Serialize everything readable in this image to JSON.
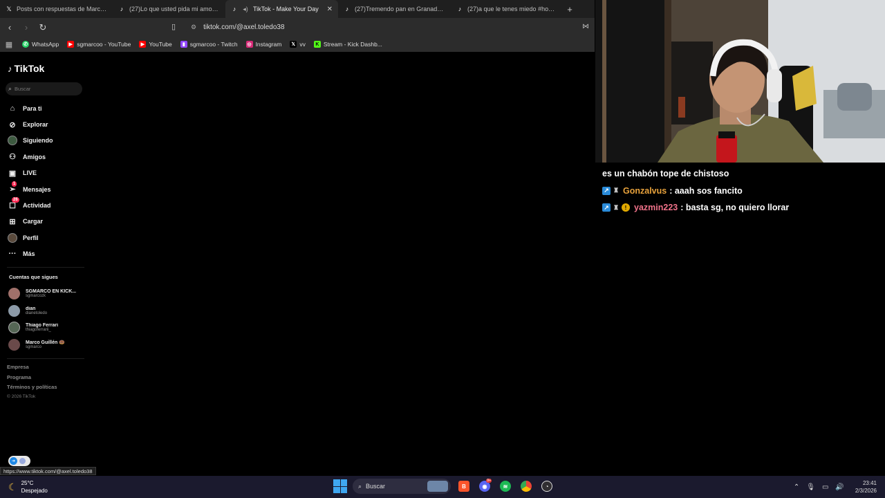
{
  "browser": {
    "tabs": [
      {
        "icon": "x-icon",
        "title": "Posts con respuestas de Marco Guillén",
        "active": false
      },
      {
        "icon": "tiktok-icon",
        "title": "(27)Lo que usted pida mi amor #fyp",
        "active": false
      },
      {
        "icon": "sound-icon",
        "title": "TikTok - Make Your Day",
        "active": true
      },
      {
        "icon": "tiktok-icon",
        "title": "(27)Tremendo pan en Granada: ¡Descubrí",
        "active": false
      },
      {
        "icon": "tiktok-icon",
        "title": "(27)a que le tenes miedo #hopecore",
        "active": false
      }
    ],
    "new_tab": "+",
    "close_glyph": "✕",
    "url": "tiktok.com/@axel.toledo38",
    "bookmarks": [
      {
        "label": "WhatsApp",
        "color": "#25d366"
      },
      {
        "label": "sgmarcoo - YouTube",
        "color": "#ff0000"
      },
      {
        "label": "YouTube",
        "color": "#ff0000"
      },
      {
        "label": "sgmarcoo - Twitch",
        "color": "#9146ff"
      },
      {
        "label": "Instagram",
        "color": "#d62976"
      },
      {
        "label": "vv",
        "color": "#000000"
      },
      {
        "label": "Stream - Kick Dashb...",
        "color": "#53fc18"
      }
    ],
    "status_url": "https://www.tiktok.com/@axel.toledo38"
  },
  "tiktok": {
    "logo": "TikTok",
    "search_placeholder": "Buscar",
    "nav": [
      {
        "label": "Para ti",
        "icon": "home-icon"
      },
      {
        "label": "Explorar",
        "icon": "compass-icon"
      },
      {
        "label": "Siguiendo",
        "icon": "following-avatar-icon"
      },
      {
        "label": "Amigos",
        "icon": "friends-icon"
      },
      {
        "label": "LIVE",
        "icon": "live-icon"
      },
      {
        "label": "Mensajes",
        "icon": "messages-icon",
        "badge": "1"
      },
      {
        "label": "Actividad",
        "icon": "activity-icon",
        "badge": "26"
      },
      {
        "label": "Cargar",
        "icon": "upload-icon"
      },
      {
        "label": "Perfil",
        "icon": "profile-avatar-icon"
      },
      {
        "label": "Más",
        "icon": "more-icon"
      }
    ],
    "following_title": "Cuentas que sigues",
    "following": [
      {
        "name": "SGMARCO EN KICK...",
        "user": "sgmarcozk",
        "color": "#a0706a"
      },
      {
        "name": "dian",
        "user": "dianetoledo",
        "color": "#8c9aa8"
      },
      {
        "name": "Thiago Ferrari",
        "user": "thiagoferrarii_",
        "color": "#556655"
      },
      {
        "name": "Marco Guillén 🍩",
        "user": "sgmarco",
        "color": "#6a4a4a"
      }
    ],
    "footer": [
      "Empresa",
      "Programa",
      "Términos y políticas"
    ],
    "copyright": "© 2026 TikTok"
  },
  "chat": [
    {
      "user": "",
      "user_color": "#ffffff",
      "text": "es un chabón tope de chistoso",
      "badges": []
    },
    {
      "user": "Gonzalvus",
      "user_color": "#e8a23c",
      "text": " : aaah sos fancito",
      "badges": [
        "arrow",
        "sword"
      ]
    },
    {
      "user": "yazmin223",
      "user_color": "#f0728a",
      "text": " : basta sg, no quiero llorar",
      "badges": [
        "arrow",
        "sword",
        "coin"
      ]
    }
  ],
  "taskbar": {
    "weather_temp": "25°C",
    "weather_desc": "Despejado",
    "search_label": "Buscar",
    "discord_badge": "9+",
    "time": "23:41",
    "date": "2/3/2026"
  }
}
